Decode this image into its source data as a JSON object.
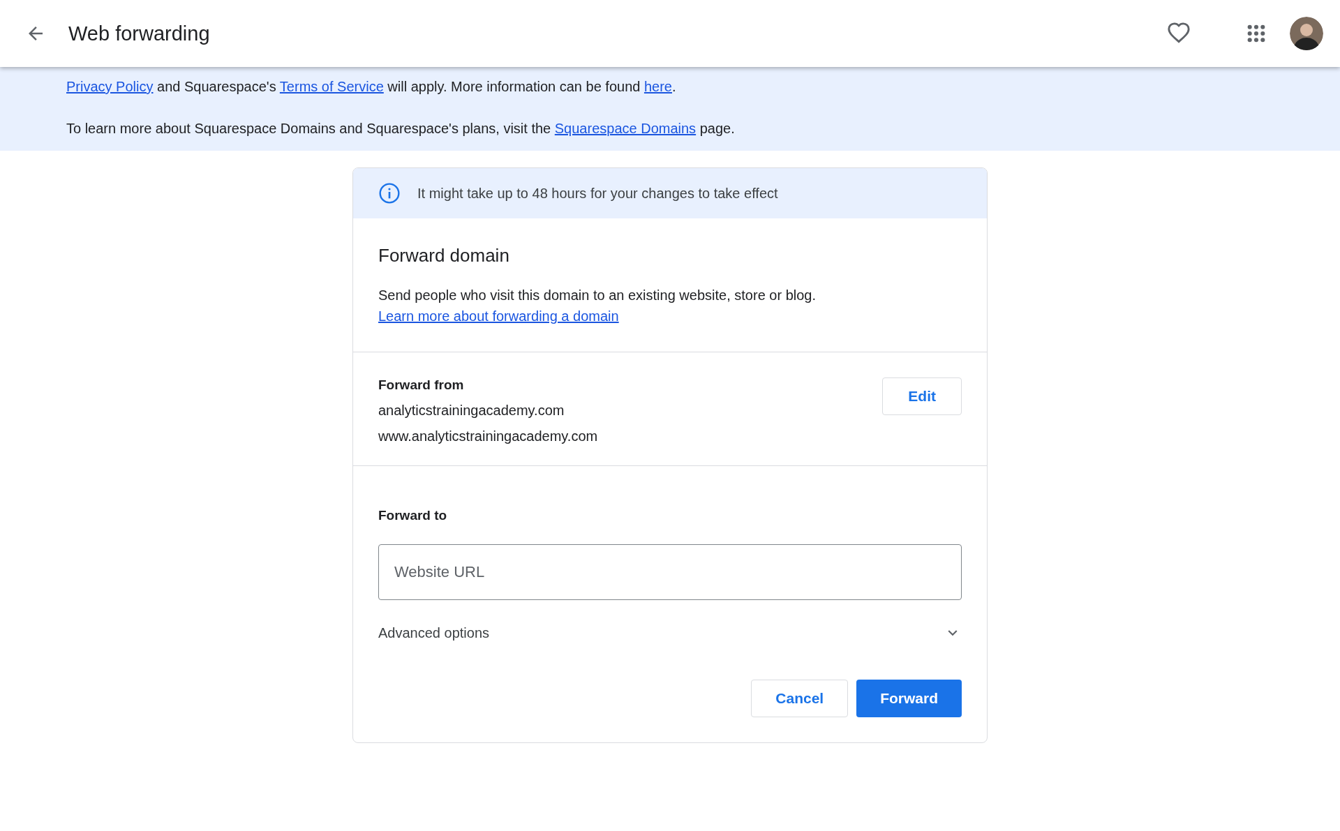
{
  "header": {
    "title": "Web forwarding"
  },
  "banner": {
    "paragraphs": [
      [
        {
          "kind": "link",
          "text": "Privacy Policy"
        },
        {
          "kind": "text",
          "text": " and Squarespace's "
        },
        {
          "kind": "link",
          "text": "Terms of Service"
        },
        {
          "kind": "text",
          "text": " will apply. More information can be found "
        },
        {
          "kind": "link",
          "text": "here"
        },
        {
          "kind": "text",
          "text": "."
        }
      ],
      [
        {
          "kind": "text",
          "text": "To learn more about Squarespace Domains and Squarespace's plans, visit the "
        },
        {
          "kind": "link",
          "text": "Squarespace Domains"
        },
        {
          "kind": "text",
          "text": " page."
        }
      ]
    ]
  },
  "card": {
    "notice": "It might take up to 48 hours for your changes to take effect",
    "heading": "Forward domain",
    "description": [
      {
        "kind": "text",
        "text": "Send people who visit this domain to an existing website, store or blog. "
      },
      {
        "kind": "link",
        "text": "Learn more about forwarding a domain"
      }
    ],
    "forward_from": {
      "label": "Forward from",
      "domains": [
        "analyticstrainingacademy.com",
        "www.analyticstrainingacademy.com"
      ],
      "edit_button": "Edit"
    },
    "forward_to": {
      "label": "Forward to",
      "placeholder": "Website URL"
    },
    "advanced_options": {
      "label": "Advanced options",
      "expanded": false
    },
    "buttons": {
      "cancel": "Cancel",
      "submit": "Forward"
    }
  }
}
